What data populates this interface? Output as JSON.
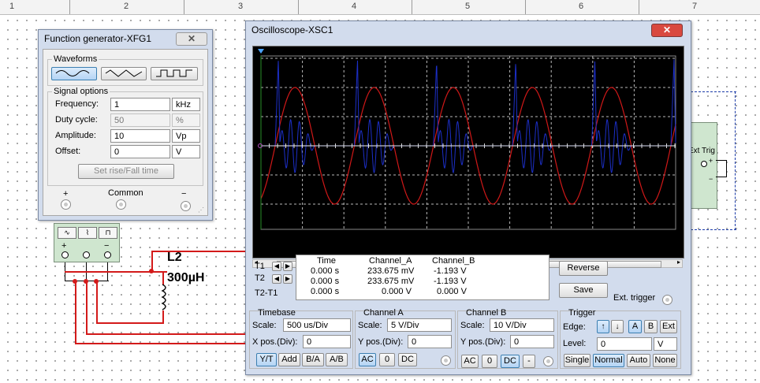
{
  "ruler": {
    "numbers": [
      "1",
      "2",
      "3",
      "4",
      "5",
      "6",
      "7"
    ]
  },
  "circuit": {
    "inductor_label": "L2",
    "inductor_value": "300µH",
    "fg_plus": "+",
    "fg_minus": "−",
    "ext_trig": "Ext Trig",
    "ext_plus": "+",
    "ext_minus": "−"
  },
  "function_generator": {
    "title": "Function generator-XFG1",
    "close_label": "✕",
    "waveforms_label": "Waveforms",
    "signal_options_label": "Signal options",
    "frequency": {
      "label": "Frequency:",
      "value": "1",
      "unit": "kHz"
    },
    "duty_cycle": {
      "label": "Duty cycle:",
      "value": "50",
      "unit": "%"
    },
    "amplitude": {
      "label": "Amplitude:",
      "value": "10",
      "unit": "Vp"
    },
    "offset": {
      "label": "Offset:",
      "value": "0",
      "unit": "V"
    },
    "rise_fall_label": "Set rise/Fall time",
    "plus_label": "+",
    "common_label": "Common",
    "minus_label": "−"
  },
  "oscilloscope": {
    "title": "Oscilloscope-XSC1",
    "close_label": "✕",
    "scroll_grip": "|||",
    "cursor_labels": {
      "t1": "T1",
      "t2": "T2",
      "t2t1": "T2-T1"
    },
    "readout": {
      "headers": [
        "Time",
        "Channel_A",
        "Channel_B"
      ],
      "rows": [
        [
          "0.000 s",
          "233.675 mV",
          "-1.193 V"
        ],
        [
          "0.000 s",
          "233.675 mV",
          "-1.193 V"
        ],
        [
          "0.000 s",
          "0.000 V",
          "0.000 V"
        ]
      ]
    },
    "reverse_label": "Reverse",
    "save_label": "Save",
    "ext_trigger_label": "Ext. trigger",
    "timebase": {
      "title": "Timebase",
      "scale_label": "Scale:",
      "scale_value": "500 us/Div",
      "xpos_label": "X pos.(Div):",
      "xpos_value": "0",
      "buttons": [
        "Y/T",
        "Add",
        "B/A",
        "A/B"
      ]
    },
    "channel_a": {
      "title": "Channel A",
      "scale_label": "Scale:",
      "scale_value": "5  V/Div",
      "ypos_label": "Y pos.(Div):",
      "ypos_value": "0",
      "buttons": [
        "AC",
        "0",
        "DC"
      ]
    },
    "channel_b": {
      "title": "Channel B",
      "scale_label": "Scale:",
      "scale_value": "10  V/Div",
      "ypos_label": "Y pos.(Div):",
      "ypos_value": "0",
      "buttons": [
        "AC",
        "0",
        "DC",
        "-"
      ]
    },
    "trigger": {
      "title": "Trigger",
      "edge_label": "Edge:",
      "edge_buttons": [
        "A",
        "B",
        "Ext"
      ],
      "level_label": "Level:",
      "level_value": "0",
      "level_unit": "V",
      "mode_buttons": [
        "Single",
        "Normal",
        "Auto",
        "None"
      ]
    },
    "colors": {
      "channel_a": "#d01818",
      "channel_b": "#1c2fc8",
      "grid": "#b8b8b8",
      "cursor": "#ffffff"
    },
    "screen": {
      "t_period_ms": 1.0,
      "ch_a_amplitude_v": 10,
      "ch_a_scale_v_per_div": 5,
      "ch_b_scale_v_per_div": 10,
      "window_ms": 5.24
    }
  }
}
